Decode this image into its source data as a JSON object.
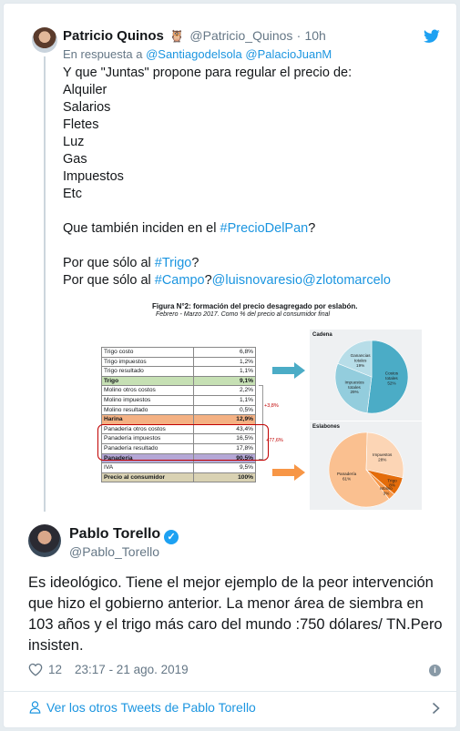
{
  "quoted": {
    "name": "Patricio Quinos",
    "handle": "@Patricio_Quinos",
    "time": "10h",
    "reply_prefix": "En respuesta a",
    "reply_to": "@Santiagodelsola @PalacioJuanM",
    "lines": [
      "Y que \"Juntas\" propone para regular el precio de:",
      "Alquiler",
      "Salarios",
      "Fletes",
      "Luz",
      "Gas",
      "Impuestos",
      "Etc"
    ],
    "q1_pre": "Que también inciden en el",
    "q1_tag": "#PrecioDelPan",
    "q1_post": "?",
    "q2_pre": "Por que sólo al",
    "q2_tag": "#Trigo",
    "q2_post": "?",
    "q3_pre": "Por que sólo al",
    "q3_tag": "#Campo",
    "q3_mid": "?",
    "q3_mentions": "@luisnovaresio@zlotomarcelo"
  },
  "figure": {
    "title": "Figura N°2: formación del precio desagregado por eslabón.",
    "subtitle": "Febrero - Marzo 2017. Como % del precio al consumidor final",
    "rows": [
      {
        "label": "Trigo costo",
        "value": "6,8%",
        "style": ""
      },
      {
        "label": "Trigo impuestos",
        "value": "1,2%",
        "style": ""
      },
      {
        "label": "Trigo resultado",
        "value": "1,1%",
        "style": ""
      },
      {
        "label": "Trigo",
        "value": "9,1%",
        "style": "hl-green"
      },
      {
        "label": "Molino otros costos",
        "value": "2,2%",
        "style": ""
      },
      {
        "label": "Molino impuestos",
        "value": "1,1%",
        "style": ""
      },
      {
        "label": "Molino resultado",
        "value": "0,5%",
        "style": ""
      },
      {
        "label": "Harina",
        "value": "12,9%",
        "style": "hl-orange"
      },
      {
        "label": "Panadería otros costos",
        "value": "43,4%",
        "style": ""
      },
      {
        "label": "Panadería impuestos",
        "value": "16,5%",
        "style": ""
      },
      {
        "label": "Panadería resultado",
        "value": "17,8%",
        "style": ""
      },
      {
        "label": "Panadería",
        "value": "90,5%",
        "style": "hl-purple"
      },
      {
        "label": "IVA",
        "value": "9,5%",
        "style": ""
      },
      {
        "label": "Precio al consumidor",
        "value": "100%",
        "style": "hl-beige"
      }
    ],
    "ann_1": "+3,8%",
    "ann_2": "+77,6%",
    "panel_top_label": "Cadena",
    "panel_bottom_label": "Eslabones",
    "colors": {
      "blue": "#4bacc6",
      "blue_light": "#93cddd",
      "blue_pale": "#b7dde8",
      "orange": "#f79646",
      "orange_light": "#fac090",
      "orange_pale": "#fcd5b5",
      "orange_dark": "#e46c0a"
    }
  },
  "chart_data": [
    {
      "type": "pie",
      "title": "Cadena",
      "slices": [
        {
          "label": "Costos totales",
          "value": 52
        },
        {
          "label": "Impuestos totales",
          "value": 29
        },
        {
          "label": "Ganancias totales",
          "value": 19
        }
      ]
    },
    {
      "type": "pie",
      "title": "Eslabones",
      "slices": [
        {
          "label": "Panadería",
          "value": 61
        },
        {
          "label": "Impuestos",
          "value": 28
        },
        {
          "label": "Trigo",
          "value": 8
        },
        {
          "label": "Molino",
          "value": 3
        }
      ]
    }
  ],
  "main": {
    "name": "Pablo Torello",
    "handle": "@Pablo_Torello",
    "text": "Es ideológico. Tiene el mejor ejemplo de la peor intervención que hizo el gobierno anterior. La menor área de siembra en 103 años y el trigo más caro del mundo :750 dólares/ TN.Pero insisten.",
    "likes": "12",
    "timestamp": "23:17 - 21 ago. 2019"
  },
  "footer": {
    "link": "Ver los otros Tweets de Pablo Torello"
  },
  "icons": [
    "twitter-bird-icon",
    "verified-icon",
    "heart-icon",
    "info-icon",
    "user-icon",
    "chevron-right-icon"
  ]
}
